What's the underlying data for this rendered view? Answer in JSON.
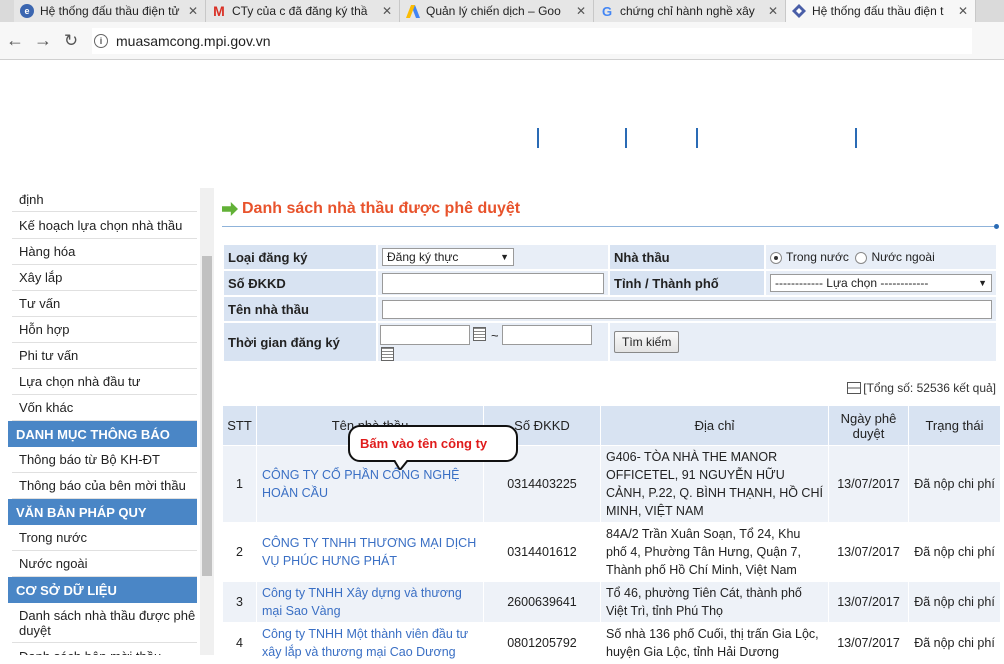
{
  "browser": {
    "tabs": [
      {
        "title": "Hệ thống đấu thầu điện tử",
        "icon": "site-icon"
      },
      {
        "title": "CTy của c đã đăng ký thầ",
        "icon": "gmail-icon"
      },
      {
        "title": "Quản lý chiến dịch – Goo",
        "icon": "google-ads-icon"
      },
      {
        "title": "chứng chỉ hành nghề xây",
        "icon": "google-icon"
      },
      {
        "title": "Hệ thống đấu thầu điện t",
        "icon": "site-icon"
      }
    ],
    "url": "muasamcong.mpi.gov.vn"
  },
  "sidebar": {
    "items_top": [
      "định",
      "Kế hoạch lựa chọn nhà thầu",
      "Hàng hóa",
      "Xây lắp",
      "Tư vấn",
      "Hỗn hợp",
      "Phi tư vấn",
      "Lựa chọn nhà đầu tư",
      "Vốn khác"
    ],
    "head1": "DANH MỤC THÔNG BÁO",
    "items_mid": [
      "Thông báo từ Bộ KH-ĐT",
      "Thông báo của bên mời thầu"
    ],
    "head2": "VĂN BẢN PHÁP QUY",
    "items_law": [
      "Trong nước",
      "Nước ngoài"
    ],
    "head3": "CƠ SỞ DỮ LIỆU",
    "items_db": [
      "Danh sách nhà thầu được phê duyệt",
      "Danh sách bên mời thầu"
    ]
  },
  "section": {
    "title": "Danh sách nhà thầu được phê duyệt"
  },
  "filter": {
    "type_label": "Loại đăng ký",
    "type_value": "Đăng ký thực",
    "contractor_label": "Nhà thầu",
    "radio_domestic": "Trong nước",
    "radio_foreign": "Nước ngoài",
    "dkkd_label": "Số ĐKKD",
    "province_label": "Tỉnh / Thành phố",
    "province_value": "------------ Lựa chọn ------------",
    "name_label": "Tên nhà thầu",
    "time_label": "Thời gian đăng ký",
    "range_sep": "~",
    "search_button": "Tìm kiếm"
  },
  "total": "[Tổng số: 52536 kết quả]",
  "table": {
    "headers": [
      "STT",
      "Tên nhà thầu",
      "Số ĐKKD",
      "Địa chỉ",
      "Ngày phê duyệt",
      "Trạng thái"
    ],
    "rows": [
      {
        "stt": "1",
        "name": "CÔNG TY CỔ PHẦN CÔNG NGHỆ HOÀN CẦU",
        "dkkd": "0314403225",
        "address": "G406- TÒA NHÀ THE MANOR OFFICETEL, 91 NGUYỄN HỮU CẢNH, P.22, Q. BÌNH THẠNH, HỒ CHÍ MINH, VIỆT NAM",
        "date": "13/07/2017",
        "status": "Đã nộp chi phí"
      },
      {
        "stt": "2",
        "name": "CÔNG TY TNHH THƯƠNG MẠI DỊCH VỤ PHÚC HƯNG PHÁT",
        "dkkd": "0314401612",
        "address": "84A/2 Trần Xuân Soạn, Tổ 24, Khu phố 4, Phường Tân Hưng, Quận 7, Thành phố Hồ Chí Minh, Việt Nam",
        "date": "13/07/2017",
        "status": "Đã nộp chi phí"
      },
      {
        "stt": "3",
        "name": "Công ty TNHH Xây dựng và thương mại Sao Vàng",
        "dkkd": "2600639641",
        "address": "Tổ 46, phường Tiên Cát, thành phố Việt Trì, tỉnh Phú Thọ",
        "date": "13/07/2017",
        "status": "Đã nộp chi phí"
      },
      {
        "stt": "4",
        "name": "Công ty TNHH Một thành viên đầu tư xây lắp và thương mại Cao Dương",
        "dkkd": "0801205792",
        "address": "Số nhà 136 phố Cuối, thị trấn Gia Lộc, huyện Gia Lộc, tỉnh Hải Dương",
        "date": "13/07/2017",
        "status": "Đã nộp chi phí"
      }
    ]
  },
  "callout": "Bấm vào tên công ty"
}
